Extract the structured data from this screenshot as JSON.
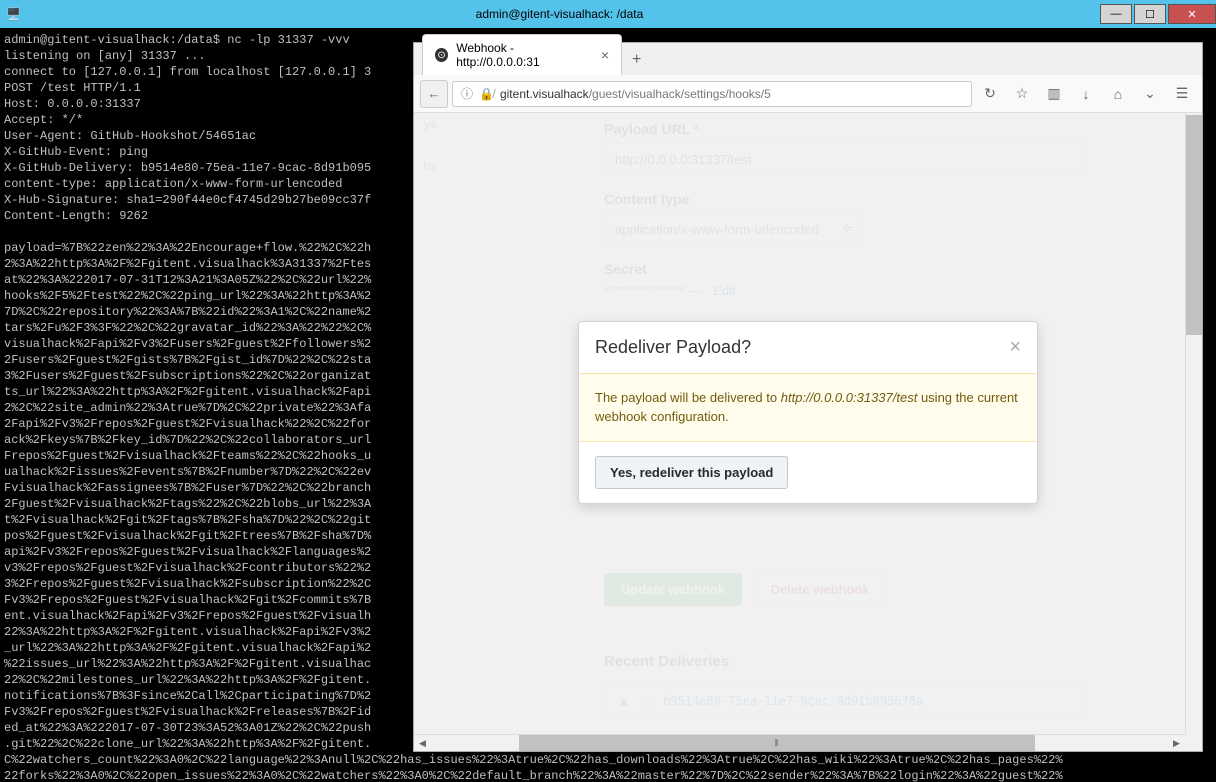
{
  "window": {
    "title": "admin@gitent-visualhack: /data"
  },
  "terminal_text": "admin@gitent-visualhack:/data$ nc -lp 31337 -vvv\nlistening on [any] 31337 ...\nconnect to [127.0.0.1] from localhost [127.0.0.1] 3\nPOST /test HTTP/1.1\nHost: 0.0.0.0:31337\nAccept: */*\nUser-Agent: GitHub-Hookshot/54651ac\nX-GitHub-Event: ping\nX-GitHub-Delivery: b9514e80-75ea-11e7-9cac-8d91b095\ncontent-type: application/x-www-form-urlencoded\nX-Hub-Signature: sha1=290f44e0cf4745d29b27be09cc37f\nContent-Length: 9262\n\npayload=%7B%22zen%22%3A%22Encourage+flow.%22%2C%22h\n2%3A%22http%3A%2F%2Fgitent.visualhack%3A31337%2Ftes\nat%22%3A%222017-07-31T12%3A21%3A05Z%22%2C%22url%22%\nhooks%2F5%2Ftest%22%2C%22ping_url%22%3A%22http%3A%2\n7D%2C%22repository%22%3A%7B%22id%22%3A1%2C%22name%2\ntars%2Fu%2F3%3F%22%2C%22gravatar_id%22%3A%22%22%2C%\nvisualhack%2Fapi%2Fv3%2Fusers%2Fguest%2Ffollowers%2\n2Fusers%2Fguest%2Fgists%7B%2Fgist_id%7D%22%2C%22sta\n3%2Fusers%2Fguest%2Fsubscriptions%22%2C%22organizat\nts_url%22%3A%22http%3A%2F%2Fgitent.visualhack%2Fapi\n2%2C%22site_admin%22%3Atrue%7D%2C%22private%22%3Afa\n2Fapi%2Fv3%2Frepos%2Fguest%2Fvisualhack%22%2C%22for\nack%2Fkeys%7B%2Fkey_id%7D%22%2C%22collaborators_url\nFrepos%2Fguest%2Fvisualhack%2Fteams%22%2C%22hooks_u\nualhack%2Fissues%2Fevents%7B%2Fnumber%7D%22%2C%22ev\nFvisualhack%2Fassignees%7B%2Fuser%7D%22%2C%22branch\n2Fguest%2Fvisualhack%2Ftags%22%2C%22blobs_url%22%3A\nt%2Fvisualhack%2Fgit%2Ftags%7B%2Fsha%7D%22%2C%22git\npos%2Fguest%2Fvisualhack%2Fgit%2Ftrees%7B%2Fsha%7D%\napi%2Fv3%2Frepos%2Fguest%2Fvisualhack%2Flanguages%2\nv3%2Frepos%2Fguest%2Fvisualhack%2Fcontributors%22%2\n3%2Frepos%2Fguest%2Fvisualhack%2Fsubscription%22%2C\nFv3%2Frepos%2Fguest%2Fvisualhack%2Fgit%2Fcommits%7B\nent.visualhack%2Fapi%2Fv3%2Frepos%2Fguest%2Fvisualh\n22%3A%22http%3A%2F%2Fgitent.visualhack%2Fapi%2Fv3%2\n_url%22%3A%22http%3A%2F%2Fgitent.visualhack%2Fapi%2\n%22issues_url%22%3A%22http%3A%2F%2Fgitent.visualhac\n22%2C%22milestones_url%22%3A%22http%3A%2F%2Fgitent.\nnotifications%7B%3Fsince%2Call%2Cparticipating%7D%2\nFv3%2Frepos%2Fguest%2Fvisualhack%2Freleases%7B%2Fid\ned_at%22%3A%222017-07-30T23%3A52%3A01Z%22%2C%22push\n.git%22%2C%22clone_url%22%3A%22http%3A%2F%2Fgitent.\nC%22watchers_count%22%3A0%2C%22language%22%3Anull%2C%22has_issues%22%3Atrue%2C%22has_downloads%22%3Atrue%2C%22has_wiki%22%3Atrue%2C%22has_pages%22%\n22forks%22%3A0%2C%22open_issues%22%3A0%2C%22watchers%22%3A0%2C%22default_branch%22%3A%22master%22%7D%2C%22sender%22%3A%7B%22login%22%3A%22guest%22%",
  "browser": {
    "tab_title": "Webhook - http://0.0.0.0:31",
    "url_host": "gitent.visualhack",
    "url_path": "/guest/visualhack/settings/hooks/5"
  },
  "sidebar": {
    "items": [
      "ys",
      "bs"
    ]
  },
  "form": {
    "payload_label": "Payload URL",
    "payload_value": "http://0.0.0.0:31337/test",
    "content_type_label": "Content type",
    "content_type_value": "application/x-www-form-urlencoded",
    "secret_label": "Secret",
    "secret_masked": "****************",
    "secret_dash": " — ",
    "edit_link": "Edit",
    "update_btn": "Update webhook",
    "delete_btn": "Delete webhook"
  },
  "recent": {
    "title": "Recent Deliveries",
    "delivery_id": "b9514e80-75ea-11e7-9cac-8d91b095678a"
  },
  "modal": {
    "title": "Redeliver Payload?",
    "body_pre": "The payload will be delivered to ",
    "body_url": "http://0.0.0.0:31337/test",
    "body_post": " using the current webhook configuration.",
    "confirm_btn": "Yes, redeliver this payload"
  }
}
